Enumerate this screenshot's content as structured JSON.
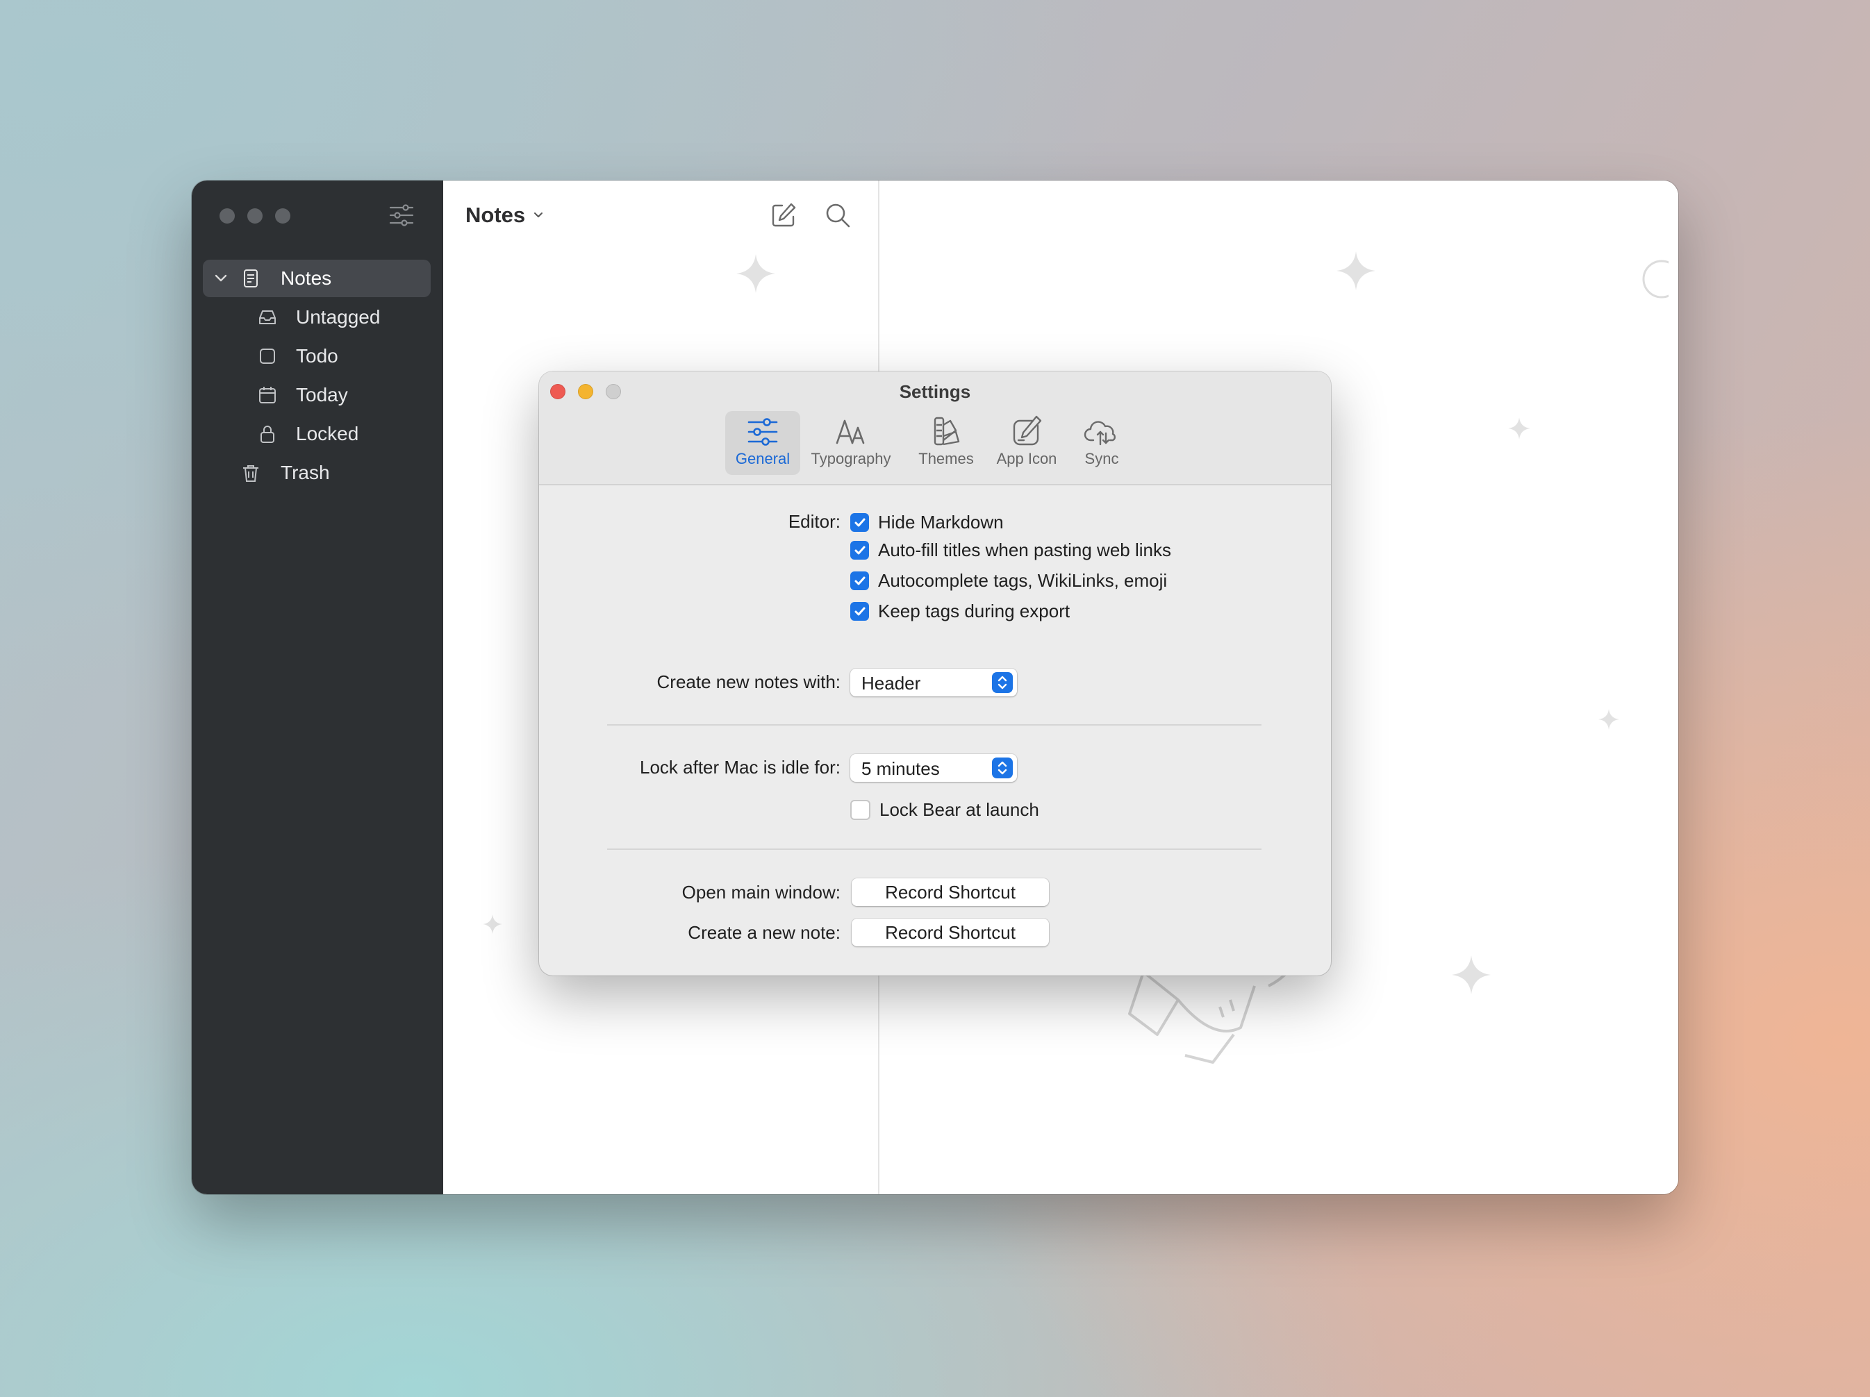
{
  "sidebar": {
    "items": [
      {
        "label": "Notes",
        "icon": "notes-icon",
        "selected": true
      },
      {
        "label": "Untagged",
        "icon": "tray-icon"
      },
      {
        "label": "Todo",
        "icon": "checkbox-icon"
      },
      {
        "label": "Today",
        "icon": "calendar-icon"
      },
      {
        "label": "Locked",
        "icon": "lock-icon"
      },
      {
        "label": "Trash",
        "icon": "trash-icon"
      }
    ]
  },
  "notes_list": {
    "title": "Notes"
  },
  "settings": {
    "title": "Settings",
    "tabs": [
      {
        "label": "General",
        "icon": "sliders-icon",
        "selected": true
      },
      {
        "label": "Typography",
        "icon": "typography-icon"
      },
      {
        "label": "Themes",
        "icon": "swatches-icon"
      },
      {
        "label": "App Icon",
        "icon": "app-icon-pencil-icon"
      },
      {
        "label": "Sync",
        "icon": "cloud-sync-icon"
      }
    ],
    "editor_label": "Editor:",
    "editor_options": [
      {
        "label": "Hide Markdown",
        "checked": true
      },
      {
        "label": "Auto-fill titles when pasting web links",
        "checked": true
      },
      {
        "label": "Autocomplete tags, WikiLinks, emoji",
        "checked": true
      },
      {
        "label": "Keep tags during export",
        "checked": true
      }
    ],
    "create_notes": {
      "label": "Create new notes with:",
      "value": "Header"
    },
    "lock_idle": {
      "label": "Lock after Mac is idle for:",
      "value": "5 minutes"
    },
    "lock_launch": {
      "label": "Lock Bear at launch",
      "checked": false
    },
    "open_main": {
      "label": "Open main window:",
      "button": "Record Shortcut"
    },
    "create_note": {
      "label": "Create a new note:",
      "button": "Record Shortcut"
    }
  },
  "colors": {
    "sidebar_bg": "#2d3033",
    "accent_blue": "#1c74e6",
    "close_red": "#ee5a52",
    "minimize_yellow": "#f4b42f"
  }
}
